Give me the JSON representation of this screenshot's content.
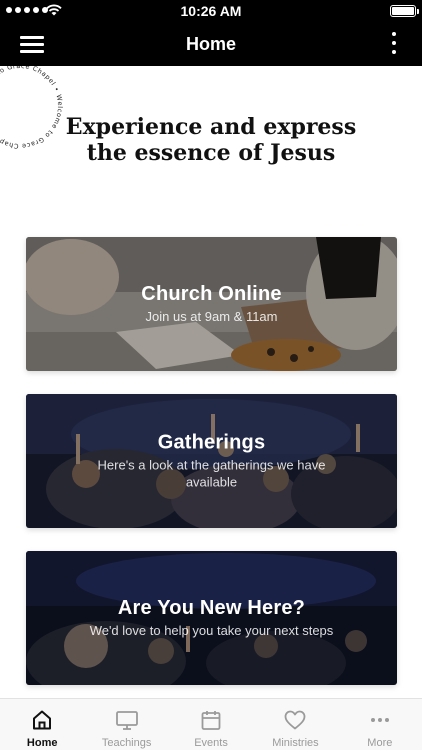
{
  "status_bar": {
    "time": "10:26 AM"
  },
  "nav": {
    "title": "Home"
  },
  "circle_text": "Welcome to Grace Chapel • Welcome to Grace Chapel •",
  "hero": {
    "line1": "Experience and express",
    "line2": "the essence of Jesus"
  },
  "cards": [
    {
      "title": "Church Online",
      "subtitle": "Join us at 9am & 11am"
    },
    {
      "title": "Gatherings",
      "subtitle": "Here's a look at the gatherings we have available"
    },
    {
      "title": "Are You New Here?",
      "subtitle": "We'd love to help you take your next steps"
    }
  ],
  "tabs": [
    {
      "label": "Home",
      "icon": "home-icon",
      "active": true
    },
    {
      "label": "Teachings",
      "icon": "tv-icon",
      "active": false
    },
    {
      "label": "Events",
      "icon": "calendar-icon",
      "active": false
    },
    {
      "label": "Ministries",
      "icon": "heart-icon",
      "active": false
    },
    {
      "label": "More",
      "icon": "more-dots-icon",
      "active": false
    }
  ],
  "colors": {
    "bar": "#000000",
    "tab_active": "#111111",
    "tab_inactive": "#9a9a9a"
  }
}
